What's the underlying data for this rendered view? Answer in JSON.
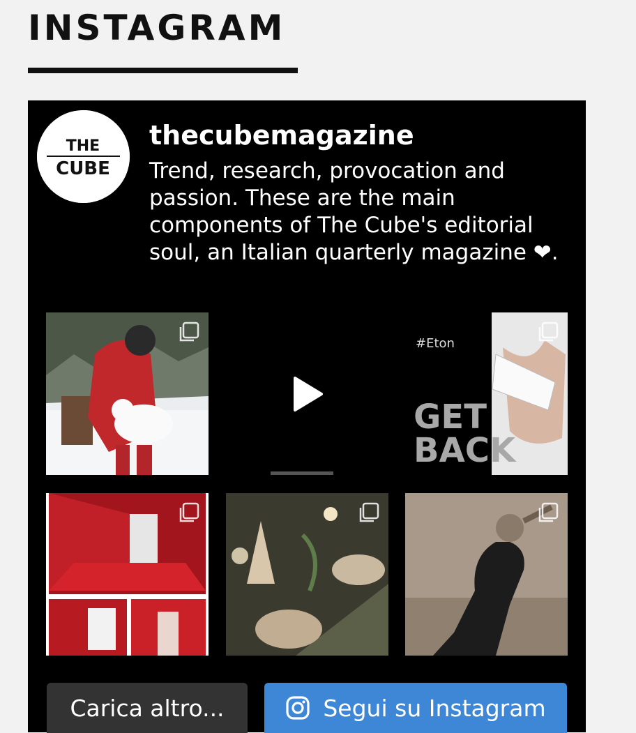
{
  "section": {
    "title": "INSTAGRAM"
  },
  "profile": {
    "username": "thecubemagazine",
    "bio": "Trend, research, provocation and passion. These are the main components of The Cube's editorial soul, an Italian quarterly magazine ❤.",
    "avatar_logo_line1": "THE",
    "avatar_logo_line2": "CUBE"
  },
  "posts": [
    {
      "kind": "carousel",
      "icon": "multiple-images-icon"
    },
    {
      "kind": "video",
      "icon": "play-icon"
    },
    {
      "kind": "carousel",
      "icon": "multiple-images-icon",
      "text_hashtag": "#Eton",
      "text_line1": "GET",
      "text_line2": "BACK"
    },
    {
      "kind": "carousel",
      "icon": "multiple-images-icon"
    },
    {
      "kind": "carousel",
      "icon": "multiple-images-icon"
    },
    {
      "kind": "carousel",
      "icon": "multiple-images-icon"
    }
  ],
  "buttons": {
    "load_more": "Carica altro...",
    "follow": "Segui su Instagram"
  },
  "colors": {
    "feed_background": "#000000",
    "page_background": "#f2f2f2",
    "load_more_button": "#333333",
    "follow_button": "#3e87d6"
  }
}
